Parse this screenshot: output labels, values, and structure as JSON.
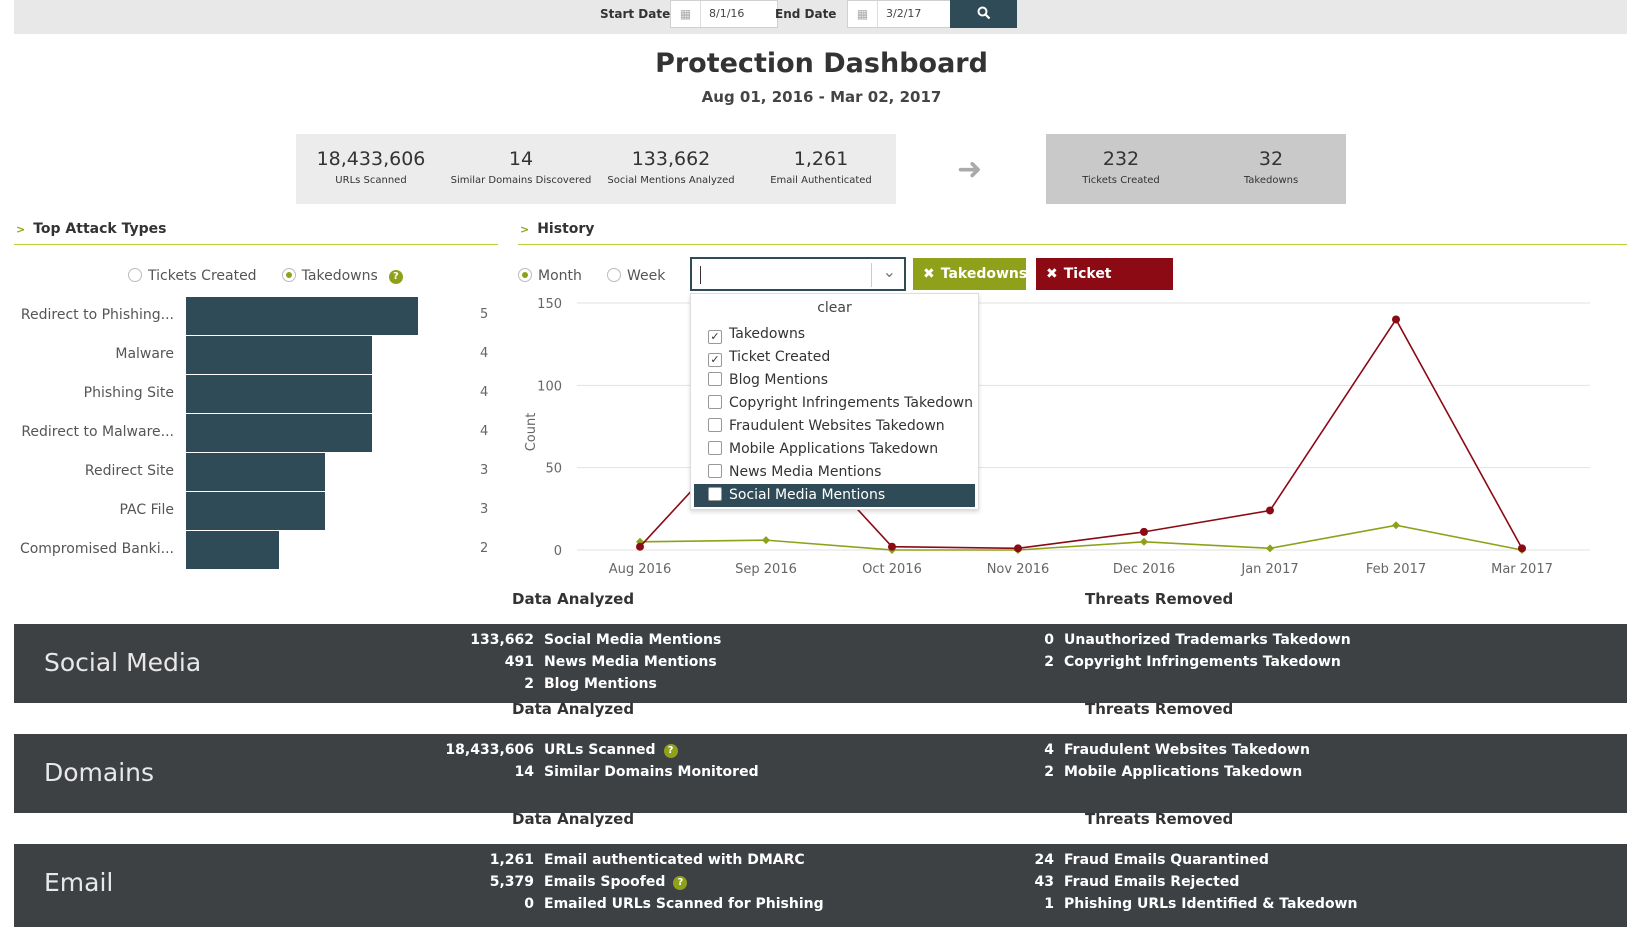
{
  "datebar": {
    "start_label": "Start Date",
    "start_value": "8/1/16",
    "end_label": "End Date",
    "end_value": "3/2/17",
    "calendar_icon": "calendar-icon",
    "search_icon": "search-icon"
  },
  "title": "Protection Dashboard",
  "subtitle": "Aug 01, 2016 - Mar 02, 2017",
  "stats": [
    {
      "value": "18,433,606",
      "label": "URLs Scanned"
    },
    {
      "value": "14",
      "label": "Similar Domains Discovered"
    },
    {
      "value": "133,662",
      "label": "Social Mentions Analyzed"
    },
    {
      "value": "1,261",
      "label": "Email Authenticated"
    }
  ],
  "outcomes": [
    {
      "value": "232",
      "label": "Tickets Created"
    },
    {
      "value": "32",
      "label": "Takedowns"
    }
  ],
  "top_attack": {
    "heading": "Top Attack Types",
    "radio_tickets": "Tickets Created",
    "radio_takedowns": "Takedowns",
    "selected": "Takedowns",
    "bars": [
      {
        "label": "Redirect to Phishing...",
        "value": 5
      },
      {
        "label": "Malware",
        "value": 4
      },
      {
        "label": "Phishing Site",
        "value": 4
      },
      {
        "label": "Redirect to Malware...",
        "value": 4
      },
      {
        "label": "Redirect Site",
        "value": 3
      },
      {
        "label": "PAC File",
        "value": 3
      },
      {
        "label": "Compromised Banki...",
        "value": 2
      }
    ]
  },
  "history": {
    "heading": "History",
    "radio_month": "Month",
    "radio_week": "Week",
    "selected": "Month",
    "tag_takedowns": "Takedowns",
    "tag_ticket": "Ticket Created",
    "dropdown": {
      "clear": "clear",
      "options": [
        {
          "label": "Takedowns",
          "checked": true
        },
        {
          "label": "Ticket Created",
          "checked": true
        },
        {
          "label": "Blog Mentions",
          "checked": false
        },
        {
          "label": "Copyright Infringements Takedown",
          "checked": false
        },
        {
          "label": "Fraudulent Websites Takedown",
          "checked": false
        },
        {
          "label": "Mobile Applications Takedown",
          "checked": false
        },
        {
          "label": "News Media Mentions",
          "checked": false
        },
        {
          "label": "Social Media Mentions",
          "checked": false,
          "highlighted": true
        }
      ]
    }
  },
  "chart_data": {
    "type": "line",
    "ylabel": "Count",
    "ylim": [
      0,
      150
    ],
    "yticks": [
      0,
      50,
      100,
      150
    ],
    "categories": [
      "Aug 2016",
      "Sep 2016",
      "Oct 2016",
      "Nov 2016",
      "Dec 2016",
      "Jan 2017",
      "Feb 2017",
      "Mar 2017"
    ],
    "series": [
      {
        "name": "Ticket Created",
        "color": "#8b0a14",
        "values": [
          2,
          85,
          2,
          1,
          11,
          24,
          140,
          1
        ]
      },
      {
        "name": "Takedowns",
        "color": "#8fa11a",
        "values": [
          5,
          6,
          0,
          0,
          5,
          1,
          15,
          0
        ]
      }
    ],
    "grid": true
  },
  "sections": [
    {
      "name": "Social Media",
      "analyzed_heading": "Data Analyzed",
      "removed_heading": "Threats Removed",
      "analyzed": [
        {
          "n": "133,662",
          "label": "Social Media Mentions"
        },
        {
          "n": "491",
          "label": "News Media Mentions"
        },
        {
          "n": "2",
          "label": "Blog Mentions"
        }
      ],
      "removed": [
        {
          "n": "0",
          "label": "Unauthorized Trademarks Takedown"
        },
        {
          "n": "2",
          "label": "Copyright Infringements Takedown"
        }
      ]
    },
    {
      "name": "Domains",
      "analyzed_heading": "Data Analyzed",
      "removed_heading": "Threats Removed",
      "analyzed": [
        {
          "n": "18,433,606",
          "label": "URLs Scanned"
        },
        {
          "n": "14",
          "label": "Similar Domains Monitored"
        }
      ],
      "removed": [
        {
          "n": "4",
          "label": "Fraudulent Websites Takedown"
        },
        {
          "n": "2",
          "label": "Mobile Applications Takedown"
        }
      ]
    },
    {
      "name": "Email",
      "analyzed_heading": "Data Analyzed",
      "removed_heading": "Threats Removed",
      "analyzed": [
        {
          "n": "1,261",
          "label": "Email authenticated with DMARC"
        },
        {
          "n": "5,379",
          "label": "Emails Spoofed"
        },
        {
          "n": "0",
          "label": "Emailed URLs Scanned for Phishing"
        }
      ],
      "removed": [
        {
          "n": "24",
          "label": "Fraud Emails Quarantined"
        },
        {
          "n": "43",
          "label": "Fraud Emails Rejected"
        },
        {
          "n": "1",
          "label": "Phishing URLs Identified & Takedown"
        }
      ]
    }
  ]
}
